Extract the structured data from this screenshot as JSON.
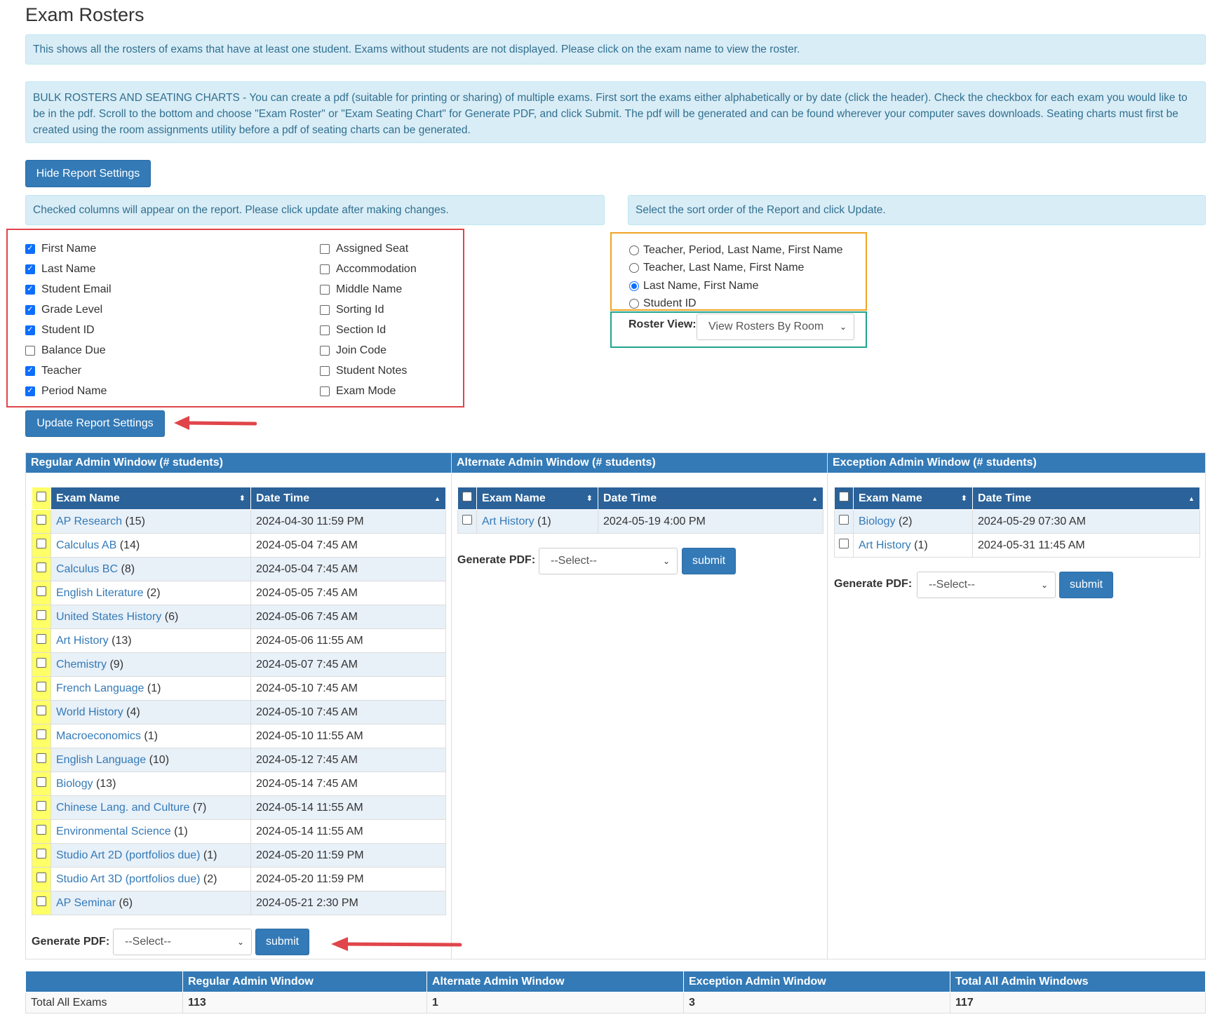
{
  "page": {
    "title": "Exam Rosters",
    "info_text": "This shows all the rosters of exams that have at least one student. Exams without students are not displayed. Please click on the exam name to view the roster.",
    "bulk_text": "BULK ROSTERS AND SEATING CHARTS - You can create a pdf (suitable for printing or sharing) of multiple exams. First sort the exams either alphabetically or by date (click the header). Check the checkbox for each exam you would like to be in the pdf. Scroll to the bottom and choose \"Exam Roster\" or \"Exam Seating Chart\" for Generate PDF, and click Submit. The pdf will be generated and can be found wherever your computer saves downloads. Seating charts must first be created using the room assignments utility before a pdf of seating charts can be generated.",
    "hide_settings_label": "Hide Report Settings",
    "columns_info": "Checked columns will appear on the report. Please click update after making changes.",
    "sort_info": "Select the sort order of the Report and click Update.",
    "update_settings_label": "Update Report Settings"
  },
  "columns": {
    "left": [
      {
        "label": "First Name",
        "checked": true
      },
      {
        "label": "Last Name",
        "checked": true
      },
      {
        "label": "Student Email",
        "checked": true
      },
      {
        "label": "Grade Level",
        "checked": true
      },
      {
        "label": "Student ID",
        "checked": true
      },
      {
        "label": "Balance Due",
        "checked": false
      },
      {
        "label": "Teacher",
        "checked": true
      },
      {
        "label": "Period Name",
        "checked": true
      }
    ],
    "right": [
      {
        "label": "Assigned Seat",
        "checked": false
      },
      {
        "label": "Accommodation",
        "checked": false
      },
      {
        "label": "Middle Name",
        "checked": false
      },
      {
        "label": "Sorting Id",
        "checked": false
      },
      {
        "label": "Section Id",
        "checked": false
      },
      {
        "label": "Join Code",
        "checked": false
      },
      {
        "label": "Student Notes",
        "checked": false
      },
      {
        "label": "Exam Mode",
        "checked": false
      }
    ]
  },
  "sort_options": [
    {
      "label": "Teacher, Period, Last Name, First Name",
      "selected": false
    },
    {
      "label": "Teacher, Last Name, First Name",
      "selected": false
    },
    {
      "label": "Last Name, First Name",
      "selected": true
    },
    {
      "label": "Student ID",
      "selected": false
    }
  ],
  "roster_view": {
    "label": "Roster View:",
    "value": "View Rosters By Room"
  },
  "table_headers": {
    "exam_name": "Exam Name",
    "date_time": "Date Time"
  },
  "generate_pdf": {
    "label": "Generate PDF:",
    "placeholder": "--Select--",
    "submit": "submit"
  },
  "windows": {
    "regular": {
      "title": "Regular Admin Window (# students)",
      "exams": [
        {
          "name": "AP Research",
          "count": "(15)",
          "date": "2024-04-30 11:59 PM"
        },
        {
          "name": "Calculus AB",
          "count": "(14)",
          "date": "2024-05-04 7:45 AM"
        },
        {
          "name": "Calculus BC",
          "count": "(8)",
          "date": "2024-05-04 7:45 AM"
        },
        {
          "name": "English Literature",
          "count": "(2)",
          "date": "2024-05-05 7:45 AM"
        },
        {
          "name": "United States History",
          "count": "(6)",
          "date": "2024-05-06 7:45 AM"
        },
        {
          "name": "Art History",
          "count": "(13)",
          "date": "2024-05-06 11:55 AM"
        },
        {
          "name": "Chemistry",
          "count": "(9)",
          "date": "2024-05-07 7:45 AM"
        },
        {
          "name": "French Language",
          "count": "(1)",
          "date": "2024-05-10 7:45 AM"
        },
        {
          "name": "World History",
          "count": "(4)",
          "date": "2024-05-10 7:45 AM"
        },
        {
          "name": "Macroeconomics",
          "count": "(1)",
          "date": "2024-05-10 11:55 AM"
        },
        {
          "name": "English Language",
          "count": "(10)",
          "date": "2024-05-12 7:45 AM"
        },
        {
          "name": "Biology",
          "count": "(13)",
          "date": "2024-05-14 7:45 AM"
        },
        {
          "name": "Chinese Lang. and Culture",
          "count": "(7)",
          "date": "2024-05-14 11:55 AM"
        },
        {
          "name": "Environmental Science",
          "count": "(1)",
          "date": "2024-05-14 11:55 AM"
        },
        {
          "name": "Studio Art 2D (portfolios due)",
          "count": "(1)",
          "date": "2024-05-20 11:59 PM"
        },
        {
          "name": "Studio Art 3D (portfolios due)",
          "count": "(2)",
          "date": "2024-05-20 11:59 PM"
        },
        {
          "name": "AP Seminar",
          "count": "(6)",
          "date": "2024-05-21 2:30 PM"
        }
      ]
    },
    "alternate": {
      "title": "Alternate Admin Window (# students)",
      "exams": [
        {
          "name": "Art History",
          "count": "(1)",
          "date": "2024-05-19 4:00 PM"
        }
      ]
    },
    "exception": {
      "title": "Exception Admin Window (# students)",
      "exams": [
        {
          "name": "Biology",
          "count": "(2)",
          "date": "2024-05-29 07:30 AM"
        },
        {
          "name": "Art History",
          "count": "(1)",
          "date": "2024-05-31 11:45 AM"
        }
      ]
    }
  },
  "totals": {
    "headers": [
      "",
      "Regular Admin Window",
      "Alternate Admin Window",
      "Exception Admin Window",
      "Total All Admin Windows"
    ],
    "row": [
      "Total All Exams",
      "113",
      "1",
      "3",
      "117"
    ]
  },
  "colors": {
    "primary": "#337ab7",
    "header_dark": "#2b6299",
    "info_bg": "#d9edf7",
    "highlight_yellow": "#ffff66",
    "annotation_red": "#e0454a",
    "annotation_orange": "#f1a324",
    "annotation_green": "#20a48e"
  }
}
